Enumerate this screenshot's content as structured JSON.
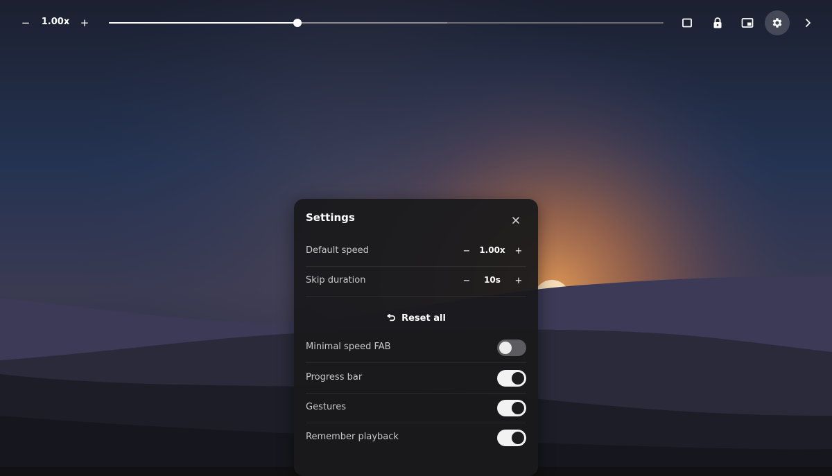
{
  "toolbar": {
    "speed_minus": "−",
    "speed_value": "1.00x",
    "speed_plus": "+",
    "progress_fraction": 0.34,
    "buffered_fraction": 0.61,
    "icons": [
      "fullscreen-icon",
      "lock-icon",
      "picture-in-picture-icon",
      "gear-icon",
      "chevron-right-icon"
    ]
  },
  "settings": {
    "title": "Settings",
    "rows": [
      {
        "label": "Default speed",
        "minus": "−",
        "value": "1.00x",
        "plus": "+"
      },
      {
        "label": "Skip duration",
        "minus": "−",
        "value": "10s",
        "plus": "+"
      }
    ],
    "reset_label": "Reset all",
    "toggles": [
      {
        "label": "Minimal speed FAB",
        "on": false
      },
      {
        "label": "Progress bar",
        "on": true
      },
      {
        "label": "Gestures",
        "on": true
      },
      {
        "label": "Remember playback",
        "on": true
      }
    ]
  },
  "colors": {
    "sky_top": "#1d2232",
    "sky_mid": "#2a3a5c",
    "glow": "#c07a45",
    "panel_bg": "#1a1a1c",
    "toggle_on": "#f2f2f2",
    "toggle_off": "#5c5c60"
  }
}
